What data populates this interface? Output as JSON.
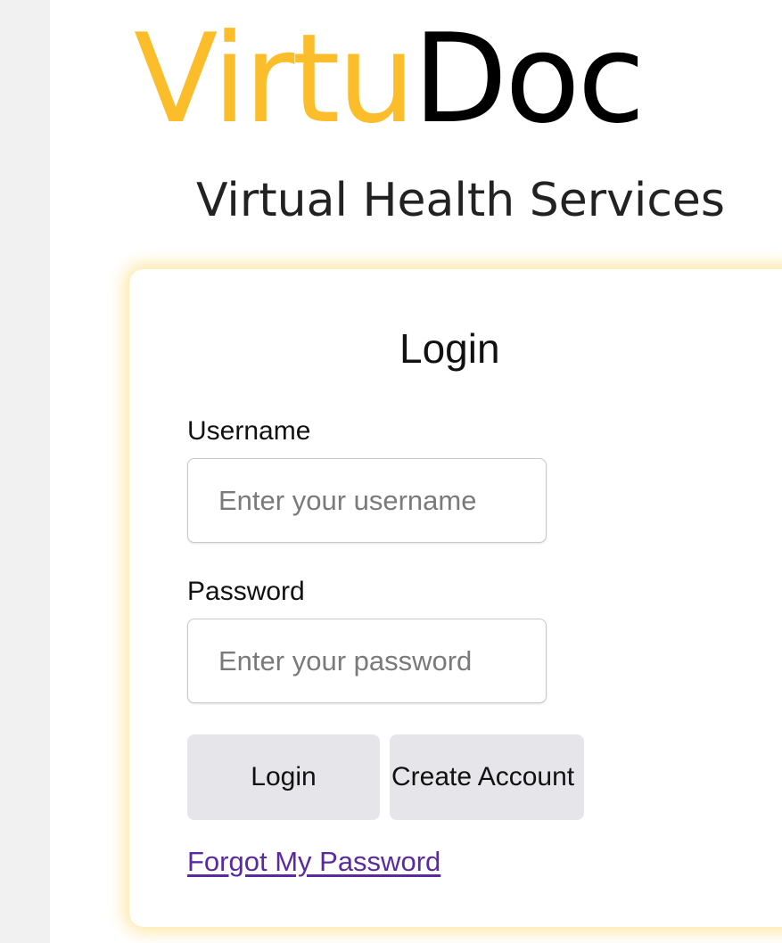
{
  "brand": {
    "name_part1": "Virtu",
    "name_part2": "Doc",
    "tagline": "Virtual Health Services"
  },
  "login_form": {
    "title": "Login",
    "username_label": "Username",
    "username_placeholder": "Enter your username",
    "password_label": "Password",
    "password_placeholder": "Enter your password",
    "login_button": "Login",
    "create_account_button": "Create Account",
    "forgot_password_link": "Forgot My Password"
  },
  "colors": {
    "brand_yellow": "#fbbd2a",
    "brand_black": "#000000",
    "card_glow": "#fbc93c",
    "button_bg": "#e6e6ea",
    "link": "#5b2aa0",
    "gutter": "#f1f1f1"
  }
}
